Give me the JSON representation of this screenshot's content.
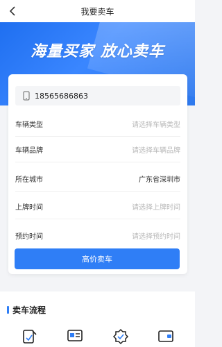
{
  "nav": {
    "title": "我要卖车"
  },
  "banner": {
    "slogan": "海量买家 放心卖车"
  },
  "form": {
    "phone": "18565686863",
    "fields": [
      {
        "label": "车辆类型",
        "value": "请选择车辆类型",
        "filled": false
      },
      {
        "label": "车辆品牌",
        "value": "请选择车辆品牌",
        "filled": false
      },
      {
        "label": "所在城市",
        "value": "广东省深圳市",
        "filled": true
      },
      {
        "label": "上牌时间",
        "value": "请选择上牌时间",
        "filled": false
      },
      {
        "label": "预约时间",
        "value": "请选择预约时间",
        "filled": false
      }
    ],
    "submit_label": "高价卖车"
  },
  "process": {
    "title": "卖车流程",
    "steps": [
      {
        "icon": "edit-form-icon"
      },
      {
        "icon": "id-card-icon"
      },
      {
        "icon": "verified-badge-icon"
      },
      {
        "icon": "wallet-icon"
      }
    ]
  },
  "colors": {
    "accent": "#2f7ef6",
    "placeholder": "#b9b9b9"
  }
}
